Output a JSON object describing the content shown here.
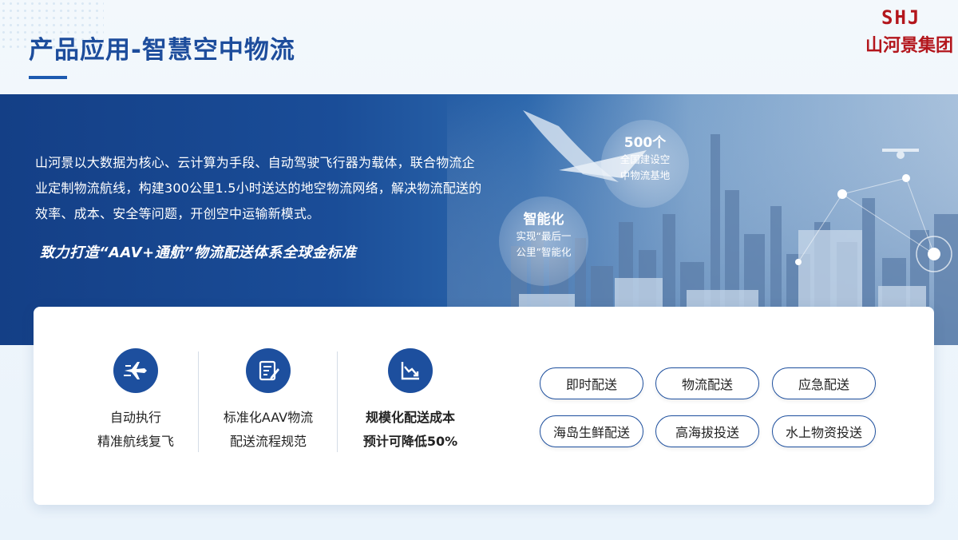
{
  "header": {
    "title": "产品应用-智慧空中物流"
  },
  "logo": {
    "mark": "SHJ",
    "name": "山河景集团"
  },
  "banner": {
    "description": "山河景以大数据为核心、云计算为手段、自动驾驶飞行器为载体，联合物流企业定制物流航线，构建300公里1.5小时送达的地空物流网络，解决物流配送的效率、成本、安全等问题，开创空中运输新模式。",
    "slogan": "致力打造“AAV+通航”物流配送体系全球金标准",
    "bubbles": [
      {
        "headline": "500个",
        "text": [
          "全国建设空",
          "中物流基地"
        ]
      },
      {
        "headline": "智能化",
        "text": [
          "实现“最后一",
          "公里”智能化"
        ]
      }
    ]
  },
  "features": [
    {
      "icon": "airplane-icon",
      "lines": [
        "自动执行",
        "精准航线复飞"
      ]
    },
    {
      "icon": "document-edit-icon",
      "lines": [
        "标准化AAV物流",
        "配送流程规范"
      ]
    },
    {
      "icon": "trend-down-chart-icon",
      "lines": [
        "规模化配送成本",
        "预计可降低50%"
      ]
    }
  ],
  "tags": [
    "即时配送",
    "物流配送",
    "应急配送",
    "海岛生鲜配送",
    "高海拔投送",
    "水上物资投送"
  ],
  "colors": {
    "primary": "#1d4f9e",
    "title": "#1d4d9c",
    "logo": "#b3161c"
  }
}
